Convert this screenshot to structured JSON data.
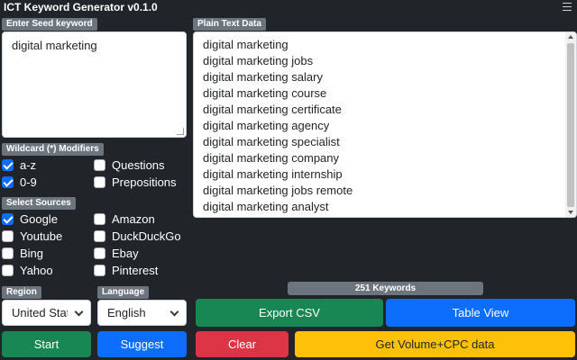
{
  "app": {
    "title": "ICT Keyword Generator v0.1.0",
    "menu_icon": "hamburger-menu-icon"
  },
  "seed": {
    "label": "Enter Seed keyword",
    "value": "digital marketing"
  },
  "plain_text": {
    "label": "Plain Text Data",
    "lines": [
      "digital marketing",
      "digital marketing jobs",
      "digital marketing salary",
      "digital marketing course",
      "digital marketing certificate",
      "digital marketing agency",
      "digital marketing specialist",
      "digital marketing company",
      "digital marketing internship",
      "digital marketing jobs remote",
      "digital marketing analyst"
    ]
  },
  "wildcard": {
    "label": "Wildcard (*) Modifiers",
    "options": [
      {
        "label": "a-z",
        "checked": true
      },
      {
        "label": "Questions",
        "checked": false
      },
      {
        "label": "0-9",
        "checked": true
      },
      {
        "label": "Prepositions",
        "checked": false
      }
    ]
  },
  "sources": {
    "label": "Select Sources",
    "options": [
      {
        "label": "Google",
        "checked": true
      },
      {
        "label": "Amazon",
        "checked": false
      },
      {
        "label": "Youtube",
        "checked": false
      },
      {
        "label": "DuckDuckGo",
        "checked": false
      },
      {
        "label": "Bing",
        "checked": false
      },
      {
        "label": "Ebay",
        "checked": false
      },
      {
        "label": "Yahoo",
        "checked": false
      },
      {
        "label": "Pinterest",
        "checked": false
      }
    ]
  },
  "region": {
    "label": "Region",
    "value": "United States"
  },
  "language": {
    "label": "Language",
    "value": "English"
  },
  "keyword_count": "251 Keywords",
  "buttons": {
    "export_csv": "Export CSV",
    "table_view": "Table View",
    "start": "Start",
    "suggest": "Suggest",
    "clear": "Clear",
    "volume_cpc": "Get Volume+CPC data"
  },
  "colors": {
    "background": "#212529",
    "label_chip": "#6c757d",
    "green": "#198754",
    "blue": "#0d6efd",
    "red": "#dc3545",
    "yellow": "#ffc107"
  }
}
